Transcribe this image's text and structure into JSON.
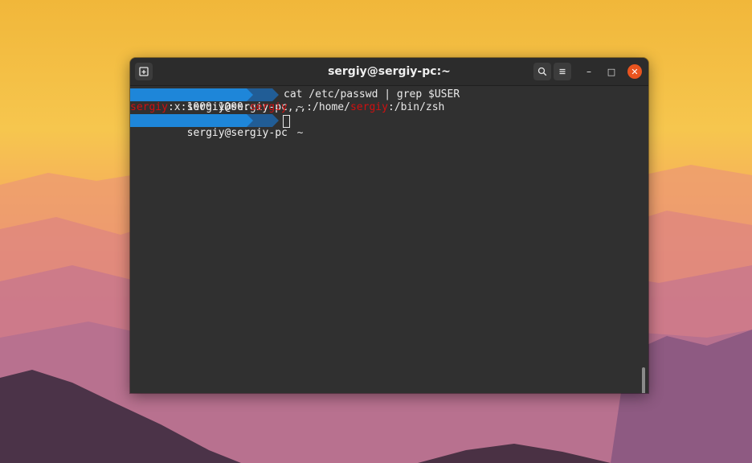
{
  "window": {
    "title": "sergiy@sergiy-pc:~",
    "new_tab_icon": "terminal-new-tab-icon",
    "search_icon": "search-icon",
    "menu_icon": "hamburger-menu-icon",
    "minimize_glyph": "–",
    "maximize_glyph": "□",
    "close_glyph": "✕"
  },
  "terminal": {
    "prompt_host": "sergiy@sergiy-pc",
    "prompt_dir": "~",
    "command": "cat /etc/passwd | grep $USER",
    "output": {
      "user1": "sergiy",
      "mid1": ":x:1000:1000:",
      "user2": "sergiy",
      "mid2": ",,,:/home/",
      "user3": "sergiy",
      "tail": ":/bin/zsh"
    }
  },
  "colors": {
    "prompt_host_bg": "#1e86d9",
    "prompt_dir_bg": "#215d96",
    "highlight_red": "#d01010",
    "close_button": "#e9541f",
    "terminal_bg": "#303030"
  }
}
